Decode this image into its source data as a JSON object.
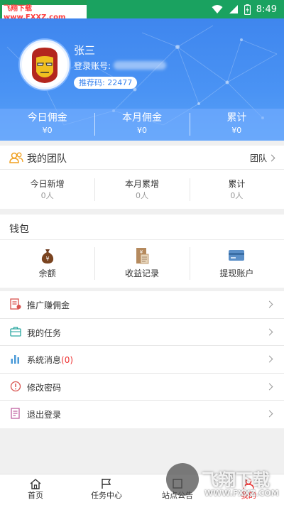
{
  "status_bar": {
    "watermark_text": "飞翔下载 www.FXXZ.com",
    "time": "8:49",
    "icons": [
      "wifi-icon",
      "signal-icon",
      "battery-icon"
    ]
  },
  "profile": {
    "name": "张三",
    "account_label": "登录账号:",
    "referral_badge": "推荐码: 22477"
  },
  "commission": [
    {
      "label": "今日佣金",
      "value": "¥0"
    },
    {
      "label": "本月佣金",
      "value": "¥0"
    },
    {
      "label": "累计",
      "value": "¥0"
    }
  ],
  "team": {
    "title": "我的团队",
    "link": "团队",
    "stats": [
      {
        "label": "今日新增",
        "value": "0人"
      },
      {
        "label": "本月累增",
        "value": "0人"
      },
      {
        "label": "累计",
        "value": "0人"
      }
    ]
  },
  "wallet": {
    "title": "钱包",
    "items": [
      {
        "label": "余额",
        "icon": "money-bag-icon"
      },
      {
        "label": "收益记录",
        "icon": "receipt-icon"
      },
      {
        "label": "提现账户",
        "icon": "bank-card-icon"
      }
    ]
  },
  "menu": {
    "items": [
      {
        "label": "推广赚佣金",
        "icon": "promote-icon"
      },
      {
        "label": "我的任务",
        "icon": "task-briefcase-icon"
      },
      {
        "label": "系统消息",
        "count": "(0)",
        "icon": "chart-icon"
      },
      {
        "label": "修改密码",
        "icon": "alert-circle-icon"
      },
      {
        "label": "退出登录",
        "icon": "logout-doc-icon"
      }
    ]
  },
  "bottom_nav": {
    "tabs": [
      {
        "label": "首页",
        "icon": "home-icon"
      },
      {
        "label": "任务中心",
        "icon": "flag-icon"
      },
      {
        "label": "站点公告",
        "icon": "notice-icon"
      },
      {
        "label": "我的",
        "icon": "user-icon"
      }
    ]
  },
  "watermark": {
    "big": "飞翔下载",
    "small": "WWW.FXXZ.COM"
  },
  "colors": {
    "header_blue": "#3f86ee",
    "status_green": "#1aa260",
    "accent_red": "#e33"
  }
}
